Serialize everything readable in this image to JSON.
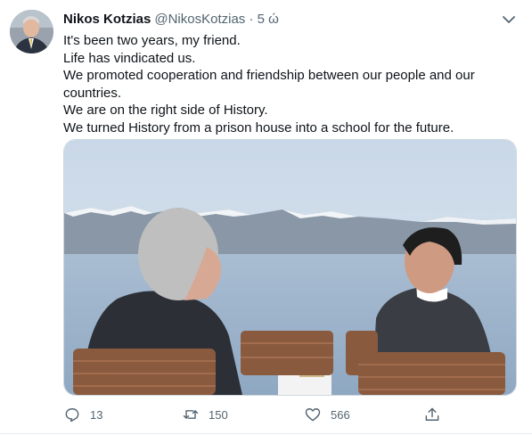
{
  "tweet": {
    "author_name": "Nikos Kotzias",
    "author_handle": "@NikosKotzias",
    "separator": "·",
    "time": "5 ώ",
    "lines": [
      "It's been two years, my friend.",
      "Life has vindicated us.",
      "We promoted cooperation and friendship between our people and our",
      "countries.",
      "We are on the right side of History.",
      "We turned History from a prison house into a school for the future."
    ]
  },
  "actions": {
    "reply_count": "13",
    "retweet_count": "150",
    "like_count": "566"
  },
  "icons": [
    "avatar",
    "chevron-down-icon",
    "reply-icon",
    "retweet-icon",
    "like-icon",
    "share-icon"
  ],
  "colors": {
    "text": "#0f1419",
    "secondary": "#536471",
    "border": "#cfd9de"
  }
}
